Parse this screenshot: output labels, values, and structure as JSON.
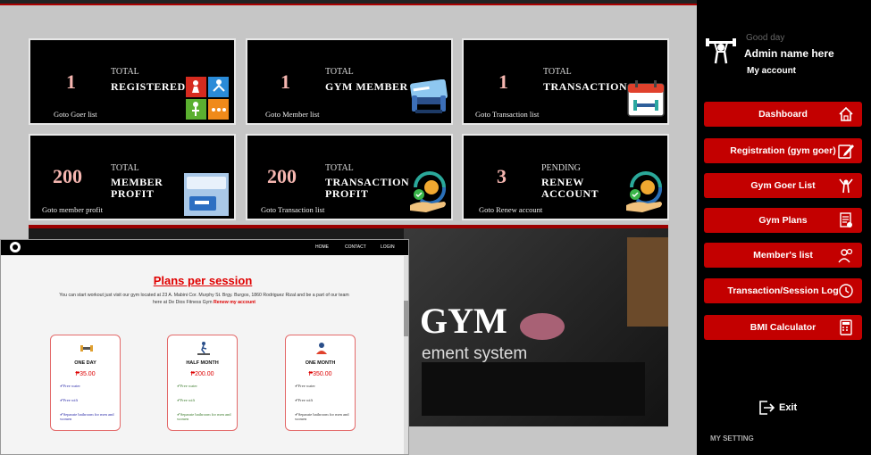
{
  "cards": [
    {
      "number": "1",
      "label_small": "TOTAL",
      "label_big": "REGISTERED",
      "link": "Goto Goer list",
      "icon": "activity-tiles-icon"
    },
    {
      "number": "1",
      "label_small": "TOTAL",
      "label_big": "GYM MEMBER",
      "link": "Goto Member list",
      "icon": "membership-card-icon"
    },
    {
      "number": "1",
      "label_small": "TOTAL",
      "label_big": "TRANSACTION",
      "link": "Goto Transaction list",
      "icon": "calendar-dumbbell-icon"
    },
    {
      "number": "200",
      "label_small": "TOTAL",
      "label_big": "MEMBER PROFIT",
      "link": "Goto member profit",
      "icon": "membership-plan-icon"
    },
    {
      "number": "200",
      "label_small": "TOTAL",
      "label_big": "TRANSACTION PROFIT",
      "link": "Goto Transaction list",
      "icon": "money-hand-icon"
    },
    {
      "number": "3",
      "label_small": "PENDING",
      "label_big": "RENEW ACCOUNT",
      "link": "Goto Renew account",
      "icon": "renew-money-icon"
    }
  ],
  "sidebar": {
    "greeting": "Good day",
    "admin_name": "Admin name here",
    "my_account": "My account",
    "items": [
      {
        "label": "Dashboard",
        "icon": "home-icon"
      },
      {
        "label": "Registration (gym goer)",
        "icon": "edit-icon"
      },
      {
        "label": "Gym Goer List",
        "icon": "trainer-icon"
      },
      {
        "label": "Gym Plans",
        "icon": "document-icon"
      },
      {
        "label": "Member's list",
        "icon": "users-icon"
      },
      {
        "label": "Transaction/Session Log",
        "icon": "log-icon"
      },
      {
        "label": "BMI Calculator",
        "icon": "calculator-icon"
      }
    ],
    "exit": "Exit",
    "my_setting": "MY SETTING"
  },
  "hero": {
    "title": "GYM",
    "subtitle": "ement system"
  },
  "browser": {
    "nav": [
      "HOME",
      "CONTACT",
      "LOGIN"
    ],
    "heading": "Plans per session",
    "intro": "You can start workout just visit our gym located at 23 A. Mabini Cor. Murphy St. Brgy. Burgos, 1860 Rodriguez Rizal and be a part of our team here at De Dios Fitness Gym",
    "intro_link": "Renew my account",
    "plans": [
      {
        "title": "ONE DAY",
        "price": "₱35.00",
        "features": [
          "Free water",
          "Free wifi",
          "Separate bathroom for men and women"
        ]
      },
      {
        "title": "HALF MONTH",
        "price": "₱200.00",
        "features": [
          "Free water",
          "Free wifi",
          "Separate bathroom for men and women"
        ]
      },
      {
        "title": "ONE MONTH",
        "price": "₱350.00",
        "features": [
          "Free water",
          "Free wifi",
          "Separate bathroom for men and women"
        ]
      }
    ]
  },
  "colors": {
    "accent": "#c30000",
    "card_number": "#f6b6b0",
    "feature_blue": "#2a2aa8",
    "feature_green": "#3a7a2a",
    "feature_dark": "#333333"
  }
}
